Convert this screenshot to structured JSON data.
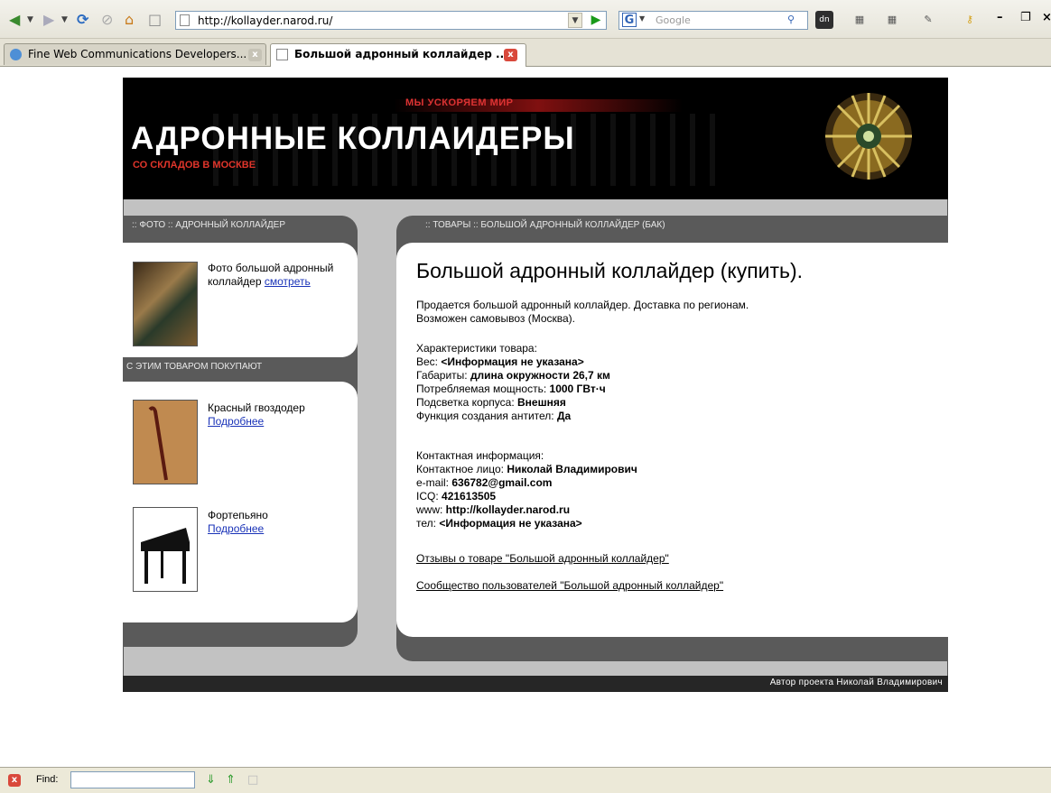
{
  "browser": {
    "url": "http://kollayder.narod.ru/",
    "search_placeholder": "Google",
    "tabs": [
      {
        "label": "Fine Web Communications Developers...",
        "active": false
      },
      {
        "label": "Большой адронный коллайдер ...",
        "active": true
      }
    ],
    "find_label": "Find:",
    "find_value": ""
  },
  "header": {
    "tagline": "МЫ УСКОРЯЕМ МИР",
    "title": "АДРОННЫЕ КОЛЛАИДЕРЫ",
    "subtitle": "СО СКЛАДОВ В МОСКВЕ"
  },
  "left": {
    "photo_heading": ":: ФОТО :: АДРОННЫЙ КОЛЛАЙДЕР",
    "photo_text": "Фото большой адронный коллайдер",
    "photo_link": "смотреть",
    "related_heading": "С ЭТИМ ТОВАРОМ ПОКУПАЮТ",
    "related": [
      {
        "name": "Красный гвоздодер",
        "link": "Подробнее"
      },
      {
        "name": "Фортепьяно",
        "link": "Подробнее"
      }
    ]
  },
  "main": {
    "heading": ":: ТОВАРЫ :: БОЛЬШОЙ АДРОННЫЙ КОЛЛАЙДЕР (БАК)",
    "title": "Большой адронный коллайдер (купить).",
    "intro_1": "Продается большой адронный коллайдер. Доставка по регионам.",
    "intro_2": "Возможен самовывоз (Москва).",
    "specs_heading": "Характеристики товара:",
    "specs": [
      {
        "label": "Вес: ",
        "value": "<Информация не указана>"
      },
      {
        "label": "Габариты: ",
        "value": "длина окружности 26,7 км"
      },
      {
        "label": "Потребляемая мощность: ",
        "value": "1000 ГВт·ч"
      },
      {
        "label": "Подсветка корпуса: ",
        "value": "Внешняя"
      },
      {
        "label": "Функция создания антител: ",
        "value": "Да"
      }
    ],
    "contacts_heading": "Контактная информация:",
    "contacts": [
      {
        "label": "Контактное лицо: ",
        "value": "Николай Владимирович"
      },
      {
        "label": "e-mail: ",
        "value": "636782@gmail.com"
      },
      {
        "label": "ICQ: ",
        "value": "421613505"
      },
      {
        "label": "www: ",
        "value": "http://kollayder.narod.ru"
      },
      {
        "label": "тел: ",
        "value": "<Информация не указана>"
      }
    ],
    "link_reviews": "Отзывы о товаре \"Большой адронный коллайдер\"",
    "link_community": "Сообщество пользователей \"Большой адронный коллайдер\""
  },
  "footer": {
    "author": "Автор проекта Николай Владимирович"
  }
}
